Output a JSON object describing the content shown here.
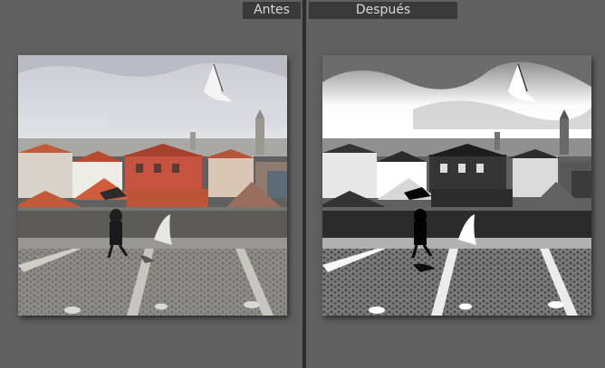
{
  "compare_view": {
    "before_label": "Antes",
    "after_label": "Después"
  },
  "colors": {
    "panel_bg": "#5f5f5f",
    "label_bg": "#3a3a3a",
    "label_text": "#d9d9d9",
    "divider": "#2b2b2b"
  }
}
